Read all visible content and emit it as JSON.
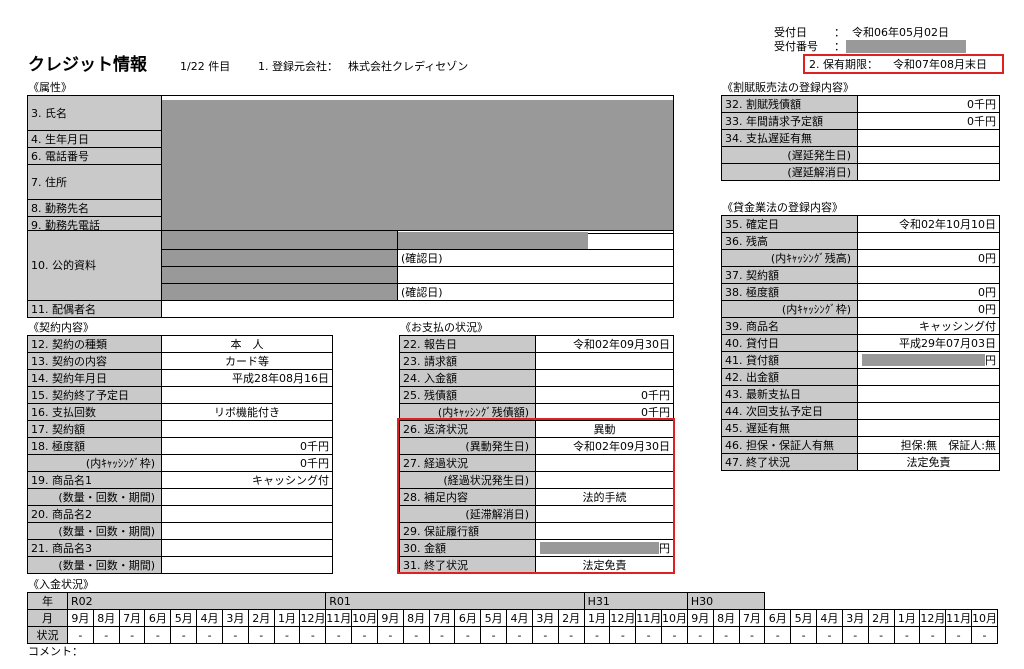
{
  "header": {
    "title": "クレジット情報",
    "count": "1/22 件目",
    "company_label": "1. 登録元会社：",
    "company": "株式会社クレディセゾン",
    "recv_date_label": "受付日",
    "recv_date": "令和06年05月02日",
    "recv_no_label": "受付番号",
    "colon": "：",
    "retention_label": "2. 保有期限：",
    "retention": "令和07年08月末日"
  },
  "attr": {
    "section": "《属性》",
    "name": "3. 氏名",
    "birth": "4. 生年月日",
    "phone": "6. 電話番号",
    "address": "7. 住所",
    "employer": "8. 勤務先名",
    "employer_phone": "9. 勤務先電話",
    "public": "10. 公的資料",
    "confirm1": "(確認日)",
    "confirm2": "(確認日)",
    "spouse": "11. 配偶者名"
  },
  "contract": {
    "section": "《契約内容》",
    "rows": [
      {
        "label": "12. 契約の種類",
        "value": "本　人",
        "align": "c"
      },
      {
        "label": "13. 契約の内容",
        "value": "カード等",
        "align": "c"
      },
      {
        "label": "14. 契約年月日",
        "value": "平成28年08月16日",
        "align": "r"
      },
      {
        "label": "15. 契約終了予定日",
        "value": "",
        "align": "r"
      },
      {
        "label": "16. 支払回数",
        "value": "リボ機能付き",
        "align": "c"
      },
      {
        "label": "17. 契約額",
        "value": "",
        "align": "r"
      },
      {
        "label": "18. 極度額",
        "value": "0千円",
        "align": "r"
      },
      {
        "label": "(内ｷｬｯｼﾝｸﾞ枠)",
        "value": "0千円",
        "align": "r",
        "indent": true
      },
      {
        "label": "19. 商品名1",
        "value": "キャッシング付",
        "align": "r"
      },
      {
        "label": "(数量・回数・期間)",
        "value": "",
        "align": "r",
        "indent": true
      },
      {
        "label": "20. 商品名2",
        "value": "",
        "align": "r"
      },
      {
        "label": "(数量・回数・期間)",
        "value": "",
        "align": "r",
        "indent": true
      },
      {
        "label": "21. 商品名3",
        "value": "",
        "align": "r"
      },
      {
        "label": "(数量・回数・期間)",
        "value": "",
        "align": "r",
        "indent": true
      }
    ]
  },
  "payment": {
    "section": "《お支払の状況》",
    "rows": [
      {
        "label": "22. 報告日",
        "value": "令和02年09月30日",
        "align": "r"
      },
      {
        "label": "23. 請求額",
        "value": "",
        "align": "r"
      },
      {
        "label": "24. 入金額",
        "value": "",
        "align": "r"
      },
      {
        "label": "25. 残債額",
        "value": "0千円",
        "align": "r"
      },
      {
        "label": "(内ｷｬｯｼﾝｸﾞ残債額)",
        "value": "0千円",
        "align": "r",
        "indent": true
      },
      {
        "label": "26. 返済状況",
        "value": "異動",
        "align": "c"
      },
      {
        "label": "(異動発生日)",
        "value": "令和02年09月30日",
        "align": "r",
        "indent": true
      },
      {
        "label": "27. 経過状況",
        "value": "",
        "align": "c"
      },
      {
        "label": "(経過状況発生日)",
        "value": "",
        "align": "r",
        "indent": true
      },
      {
        "label": "28. 補足内容",
        "value": "法的手続",
        "align": "c"
      },
      {
        "label": "(延滞解消日)",
        "value": "",
        "align": "r",
        "indent": true
      },
      {
        "label": "29. 保証履行額",
        "value": "",
        "align": "r"
      },
      {
        "label": "30. 金額",
        "value": "円",
        "align": "r",
        "redact": true
      },
      {
        "label": "31. 終了状況",
        "value": "法定免責",
        "align": "c"
      }
    ]
  },
  "installment": {
    "section": "《割賦販売法の登録内容》",
    "rows": [
      {
        "label": "32. 割賦残債額",
        "value": "0千円"
      },
      {
        "label": "33. 年間請求予定額",
        "value": "0千円"
      },
      {
        "label": "34. 支払遅延有無",
        "value": ""
      },
      {
        "label": "(遅延発生日)",
        "value": "",
        "indent": true
      },
      {
        "label": "(遅延解消日)",
        "value": "",
        "indent": true
      }
    ]
  },
  "lending": {
    "section": "《貸金業法の登録内容》",
    "rows": [
      {
        "label": "35. 確定日",
        "value": "令和02年10月10日",
        "align": "r"
      },
      {
        "label": "36. 残高",
        "value": "",
        "align": "r"
      },
      {
        "label": "(内ｷｬｯｼﾝｸﾞ残高)",
        "value": "0円",
        "align": "r",
        "indent": true
      },
      {
        "label": "37. 契約額",
        "value": "",
        "align": "r"
      },
      {
        "label": "38. 極度額",
        "value": "0円",
        "align": "r"
      },
      {
        "label": "(内ｷｬｯｼﾝｸﾞ枠)",
        "value": "0円",
        "align": "r",
        "indent": true
      },
      {
        "label": "39. 商品名",
        "value": "キャッシング付",
        "align": "r"
      },
      {
        "label": "40. 貸付日",
        "value": "平成29年07月03日",
        "align": "r"
      },
      {
        "label": "41. 貸付額",
        "value": "円",
        "align": "r",
        "redact": true
      },
      {
        "label": "42. 出金額",
        "value": "",
        "align": "r"
      },
      {
        "label": "43. 最新支払日",
        "value": "",
        "align": "r"
      },
      {
        "label": "44. 次回支払予定日",
        "value": "",
        "align": "r"
      },
      {
        "label": "45. 遅延有無",
        "value": "",
        "align": "r"
      },
      {
        "label": "46. 担保・保証人有無",
        "value": "担保:無　保証人:無",
        "align": "r"
      },
      {
        "label": "47. 終了状況",
        "value": "法定免責",
        "align": "c"
      }
    ]
  },
  "history": {
    "section": "《入金状況》",
    "year_label": "年",
    "month_label": "月",
    "status_label": "状況",
    "years": [
      {
        "name": "R02",
        "span": 10
      },
      {
        "name": "R01",
        "span": 10
      },
      {
        "name": "H31",
        "span": 4
      },
      {
        "name": "H30",
        "span": 3
      }
    ],
    "months": [
      "9月",
      "8月",
      "7月",
      "6月",
      "5月",
      "4月",
      "3月",
      "2月",
      "1月",
      "12月",
      "11月",
      "10月",
      "9月",
      "8月",
      "7月",
      "6月",
      "5月",
      "4月",
      "3月",
      "2月",
      "1月",
      "12月",
      "11月",
      "10月",
      "9月",
      "8月",
      "7月",
      "6月",
      "5月",
      "4月",
      "3月",
      "2月",
      "1月",
      "12月",
      "11月",
      "10月"
    ],
    "statuses": [
      "-",
      "-",
      "-",
      "-",
      "-",
      "-",
      "-",
      "-",
      "-",
      "-",
      "-",
      "-",
      "-",
      "-",
      "-",
      "-",
      "-",
      "-",
      "-",
      "-",
      "-",
      "-",
      "-",
      "-",
      "-",
      "-",
      "-",
      "-",
      "-",
      "-",
      "-",
      "-",
      "-",
      "-",
      "-",
      "-"
    ],
    "comment_label": "コメント："
  },
  "colors": {
    "label_bg": "#c9c9c9",
    "redaction": "#999999",
    "highlight": "#e02020"
  }
}
